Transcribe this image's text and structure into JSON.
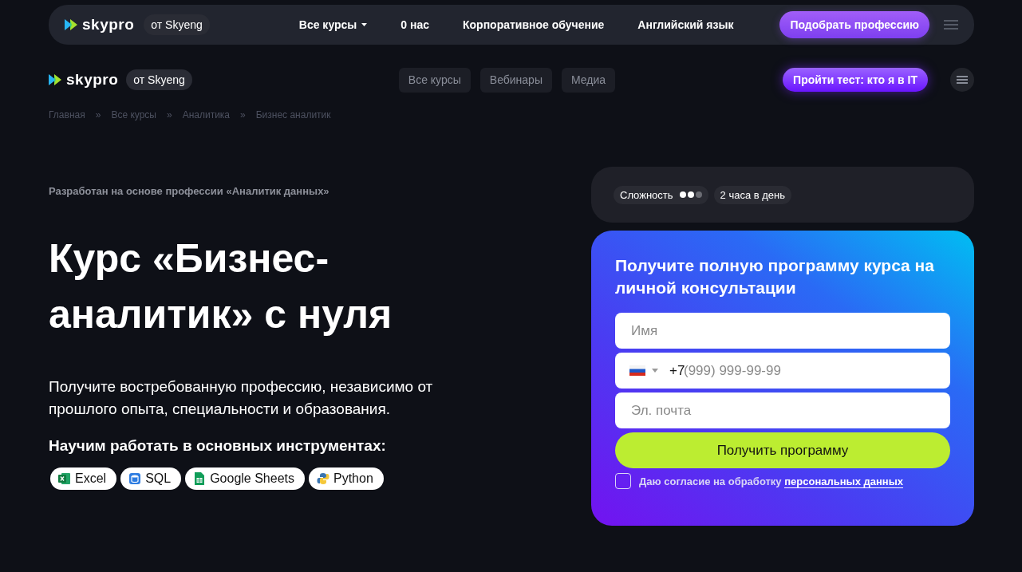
{
  "topbar": {
    "logo": "skypro",
    "badge": "от Skyeng",
    "nav": [
      {
        "label": "Все курсы",
        "kind": "dropdown"
      },
      {
        "label": "0 нас",
        "kind": "link"
      },
      {
        "label": "Корпоративное обучение",
        "kind": "link"
      },
      {
        "label": "Английский язык",
        "kind": "link"
      }
    ],
    "cta": "Подобрать профессию"
  },
  "header": {
    "logo": "skypro",
    "badge": "от Skyeng",
    "nav": [
      "Все курсы",
      "Вебинары",
      "Медиа"
    ],
    "cta": "Пройти тест: кто я в IT"
  },
  "breadcrumbs": {
    "items": [
      "Главная",
      "Все курсы",
      "Аналитика",
      "Бизнес аналитик"
    ],
    "separators": [
      "»",
      "»",
      "»"
    ]
  },
  "hero": {
    "eyebrow": "Разработан на основе профессии «Аналитик данных»",
    "title": "Курс «Бизнес-аналитик» с нуля",
    "subtitle": "Получите востребованную профессию, независимо от прошлого опыта, специальности и образования.",
    "tools_heading": "Научим работать в основных инструментах:",
    "tools": [
      {
        "label": "Excel",
        "kind": "excel"
      },
      {
        "label": "SQL",
        "kind": "sql"
      },
      {
        "label": "Google Sheets",
        "kind": "sheets"
      },
      {
        "label": "Python",
        "kind": "python"
      }
    ]
  },
  "info": {
    "difficulty_label": "Сложность",
    "stars": 2,
    "hours": "2 часа в день"
  },
  "form": {
    "title": "Получите полную программу курса на личной консультации",
    "fields": [
      {
        "kind": "text",
        "placeholder": "Имя"
      },
      {
        "kind": "phone",
        "prefix": "+7",
        "placeholder": "(999) 999-99-99"
      },
      {
        "kind": "text",
        "placeholder": "Эл. почта"
      }
    ],
    "submit": "Получить программу",
    "consent": {
      "text": "Даю согласие на обработку",
      "link": "персональных данных",
      "checked": false
    }
  }
}
